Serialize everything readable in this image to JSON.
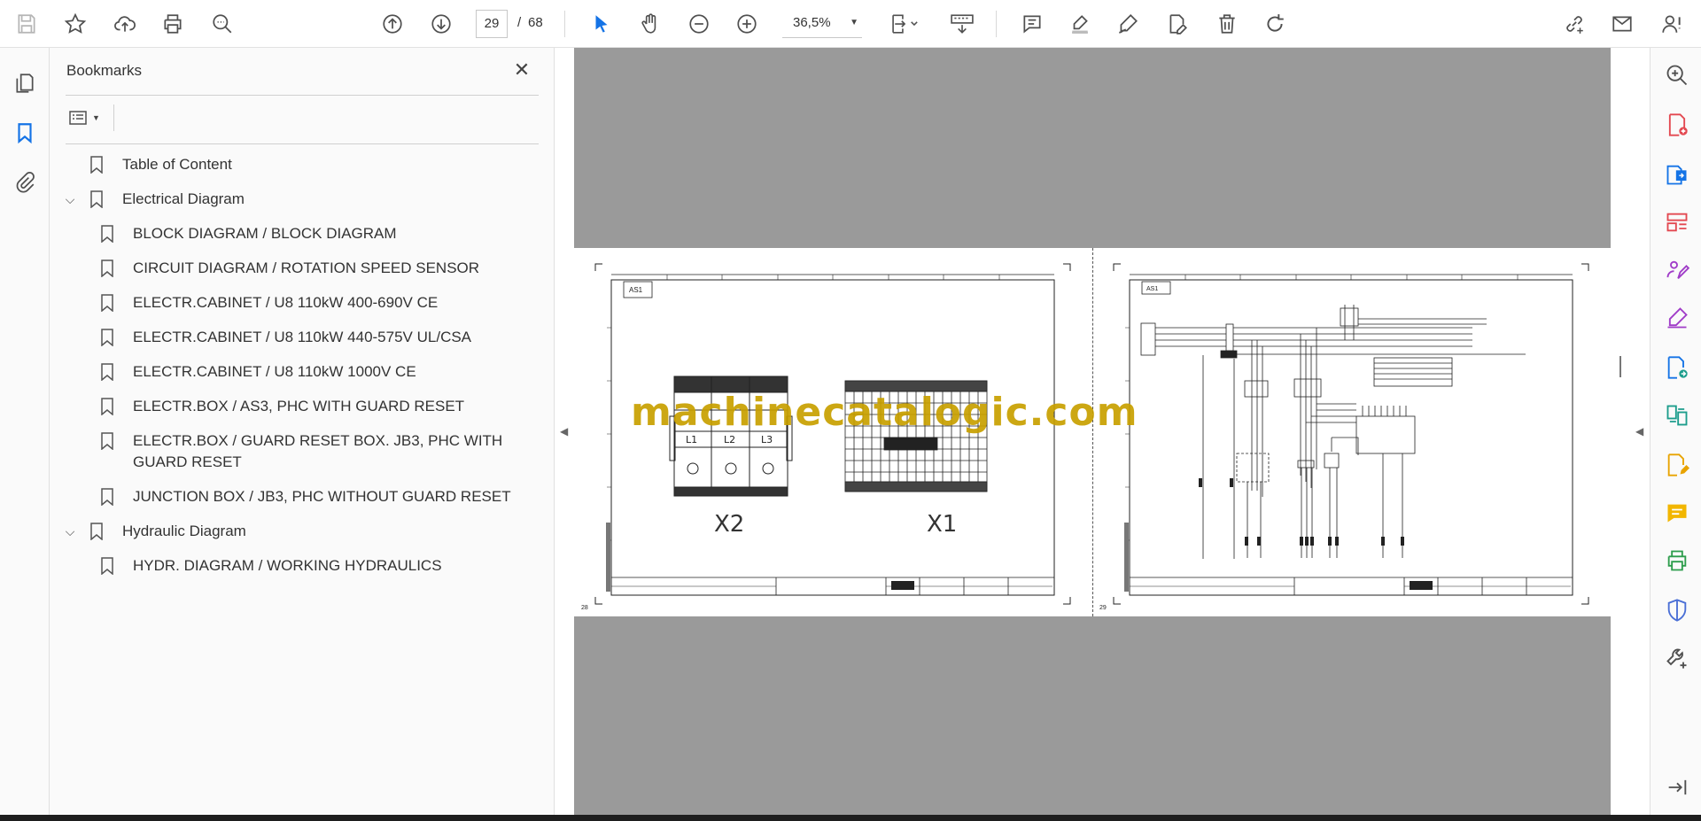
{
  "toolbar": {
    "current_page": "29",
    "page_separator": "/",
    "total_pages": "68",
    "zoom": "36,5%"
  },
  "bookmarks": {
    "title": "Bookmarks",
    "items": [
      {
        "label": "Table of Content"
      },
      {
        "label": "Electrical Diagram"
      },
      {
        "label": "BLOCK DIAGRAM / BLOCK DIAGRAM"
      },
      {
        "label": "CIRCUIT DIAGRAM / ROTATION SPEED SENSOR"
      },
      {
        "label": "ELECTR.CABINET / U8 110kW 400-690V CE"
      },
      {
        "label": "ELECTR.CABINET / U8 110kW 440-575V UL/CSA"
      },
      {
        "label": "ELECTR.CABINET / U8 110kW 1000V CE"
      },
      {
        "label": "ELECTR.BOX / AS3, PHC WITH GUARD RESET"
      },
      {
        "label": "ELECTR.BOX / GUARD RESET BOX. JB3, PHC WITH GUARD RESET"
      },
      {
        "label": "JUNCTION BOX / JB3, PHC WITHOUT GUARD RESET"
      },
      {
        "label": "Hydraulic Diagram"
      },
      {
        "label": "HYDR. DIAGRAM / WORKING HYDRAULICS"
      }
    ]
  },
  "document": {
    "left_page": {
      "sheet_label": "AS1",
      "page_num": "28",
      "terminal_x2": "X2",
      "terminal_x1": "X1",
      "phase_labels": [
        "L1",
        "L2",
        "L3"
      ]
    },
    "right_page": {
      "sheet_label": "AS1",
      "page_num": "29"
    },
    "watermark": "machinecatalogic.com"
  },
  "colors": {
    "accent": "#1473e6",
    "icon": "#505050",
    "gray_bg": "#9a9a9a",
    "watermark": "#c8a000"
  }
}
